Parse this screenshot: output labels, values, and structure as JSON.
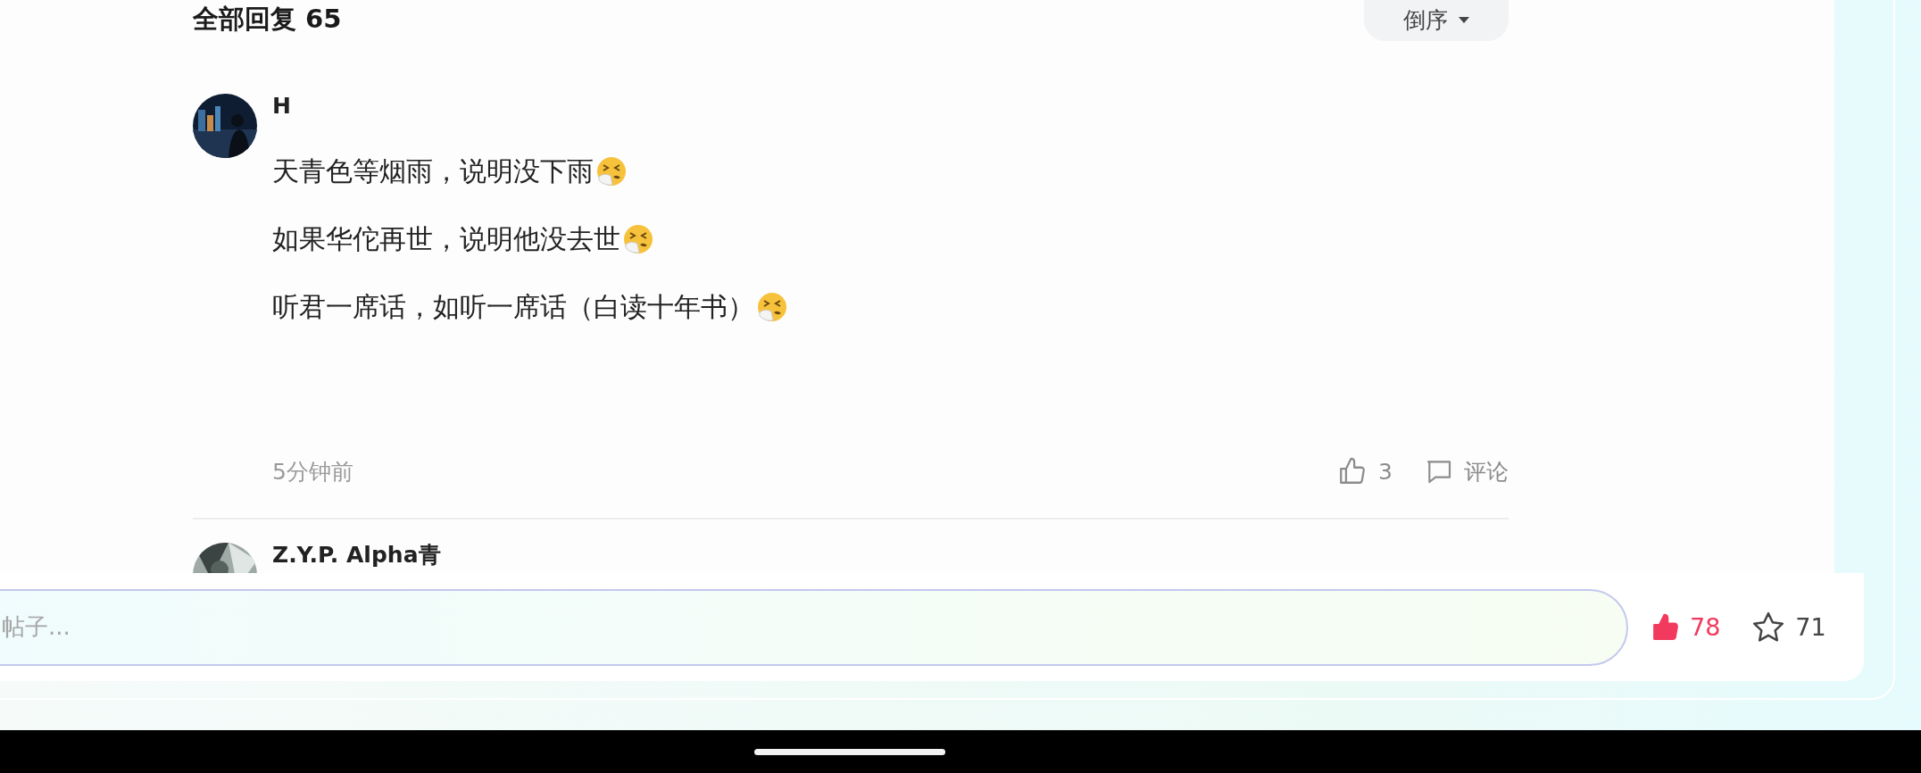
{
  "replies_header": {
    "title": "全部回复",
    "count": "65",
    "sort_button": "倒序"
  },
  "comments": [
    {
      "author": "H",
      "lines": [
        {
          "text": "天青色等烟雨，说明没下雨",
          "emoji": true
        },
        {
          "text": "如果华佗再世，说明他没去世",
          "emoji": true
        },
        {
          "text": "听君一席话，如听一席话（白读十年书）",
          "emoji": true
        }
      ],
      "time": "5分钟前",
      "likes": "3",
      "comment_label": "评论"
    },
    {
      "author": "Z.Y.P. Alpha青"
    }
  ],
  "bottom_bar": {
    "placeholder": "帖子...",
    "likes": "78",
    "liked": true,
    "stars": "71",
    "starred": false
  }
}
